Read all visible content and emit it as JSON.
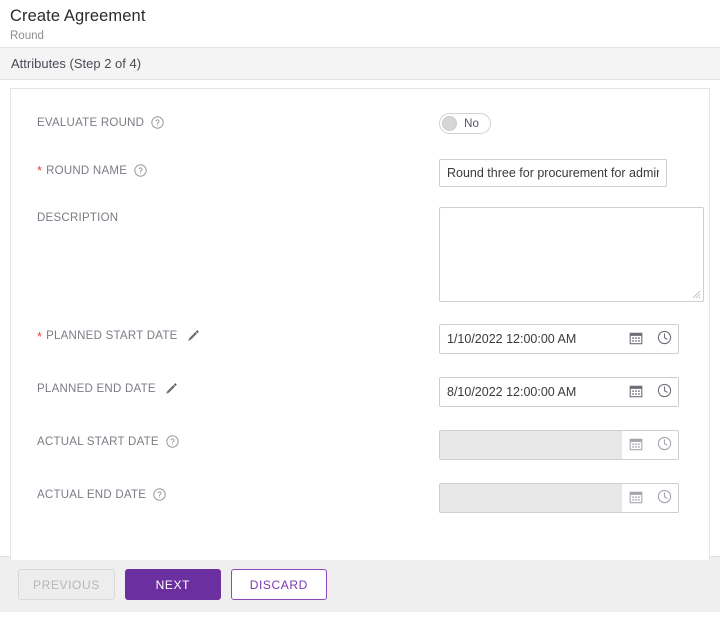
{
  "header": {
    "title": "Create Agreement",
    "subtitle": "Round"
  },
  "step_bar": {
    "label": "Attributes (Step 2 of 4)"
  },
  "colors": {
    "accent_purple": "#6b2fa0",
    "outline_purple": "#8c4bbd",
    "required_star": "#e8453c",
    "label_gray": "#7b7b85",
    "footer_bg": "#efefef",
    "step_bar_bg": "#f4f4f4",
    "disabled_input_bg": "#e7e7e7"
  },
  "form": {
    "fields": [
      {
        "key": "evaluate_round",
        "label": "EVALUATE ROUND",
        "required": false,
        "icon": "help-icon",
        "control": "toggle",
        "toggle_value": "No",
        "toggle_state": "off"
      },
      {
        "key": "round_name",
        "label": "ROUND NAME",
        "required": true,
        "icon": "help-icon",
        "control": "text",
        "value": "Round three for procurement for admin department",
        "placeholder": ""
      },
      {
        "key": "description",
        "label": "DESCRIPTION",
        "required": false,
        "icon": "none",
        "control": "textarea",
        "value": "",
        "placeholder": ""
      },
      {
        "key": "planned_start_date",
        "label": "PLANNED START DATE",
        "required": true,
        "icon": "pencil-icon",
        "control": "date",
        "value": "1/10/2022 12:00:00 AM",
        "disabled": false
      },
      {
        "key": "planned_end_date",
        "label": "PLANNED END DATE",
        "required": false,
        "icon": "pencil-icon",
        "control": "date",
        "value": "8/10/2022 12:00:00 AM",
        "disabled": false
      },
      {
        "key": "actual_start_date",
        "label": "ACTUAL START DATE",
        "required": false,
        "icon": "help-icon",
        "control": "date",
        "value": "",
        "disabled": true
      },
      {
        "key": "actual_end_date",
        "label": "ACTUAL END DATE",
        "required": false,
        "icon": "help-icon",
        "control": "date",
        "value": "",
        "disabled": true
      }
    ],
    "date_icons": {
      "calendar": "calendar-icon",
      "clock": "clock-icon"
    }
  },
  "footer": {
    "previous_label": "PREVIOUS",
    "next_label": "NEXT",
    "discard_label": "DISCARD"
  }
}
